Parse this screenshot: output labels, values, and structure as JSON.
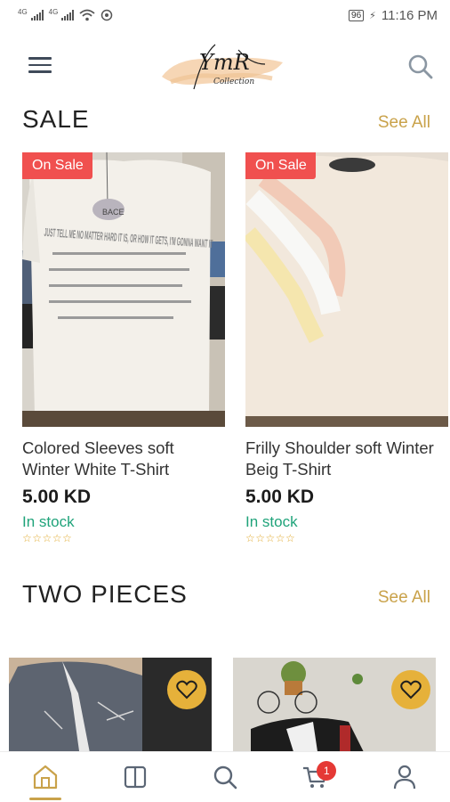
{
  "status_bar": {
    "network_1": "4G",
    "network_2": "4G",
    "battery": "96",
    "charging_glyph": "⚡",
    "time": "11:16 PM",
    "icons": [
      "signal-icon",
      "signal-icon",
      "wifi-icon",
      "hotspot-icon",
      "battery-icon"
    ]
  },
  "header": {
    "logo_text_main": "YmR",
    "logo_text_sub": "Collection",
    "menu_icon": "hamburger-menu-icon",
    "search_icon": "search-icon"
  },
  "sale_section": {
    "title": "SALE",
    "see_all": "See All",
    "products": [
      {
        "badge": "On Sale",
        "name": "Colored Sleeves soft Winter White T-Shirt",
        "price": "5.00 KD",
        "stock": "In stock",
        "stars": "☆☆☆☆☆",
        "shirt_text": "JUST TELL ME NO MATTER HARD IT IS, OR HOW IT GETS, I'M GONNA WANT IT",
        "tag_text": "BACE"
      },
      {
        "badge": "On Sale",
        "name": "Frilly Shoulder soft Winter Beig T-Shirt",
        "price": "5.00 KD",
        "stock": "In stock",
        "stars": "☆☆☆☆☆"
      }
    ]
  },
  "two_pieces_section": {
    "title": "TWO PIECES",
    "see_all": "See All"
  },
  "bottom_nav": {
    "items": [
      "home-icon",
      "catalog-icon",
      "search-icon",
      "cart-icon",
      "profile-icon"
    ],
    "cart_count": "1",
    "active": "home"
  },
  "colors": {
    "accent": "#c9a24a",
    "sale_badge": "#f0504f",
    "in_stock": "#1fa37a",
    "cart_badge": "#e53935",
    "favorite_button": "#e6b13a"
  }
}
